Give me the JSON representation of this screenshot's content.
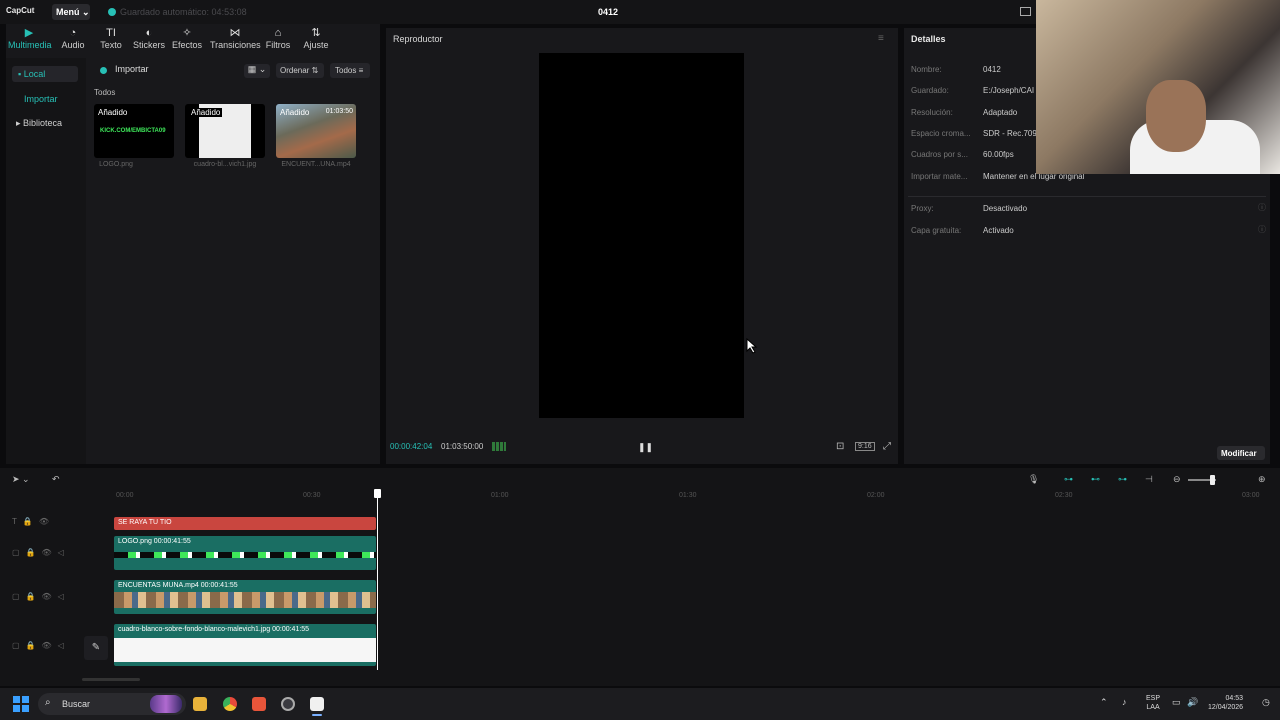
{
  "colors": {
    "accent": "#27c0b6",
    "clip_red": "#c9463f",
    "clip_teal": "#1a6e63"
  },
  "titlebar": {
    "logo": "CapCut",
    "menu_label": "Menú",
    "autosave": "Guardado automático: 04:53:08",
    "project_title": "0412"
  },
  "tools": [
    {
      "label": "Multimedia",
      "icon": "media-icon"
    },
    {
      "label": "Audio",
      "icon": "audio-icon"
    },
    {
      "label": "Texto",
      "icon": "text-icon"
    },
    {
      "label": "Stickers",
      "icon": "sticker-icon"
    },
    {
      "label": "Efectos",
      "icon": "effects-icon"
    },
    {
      "label": "Transiciones",
      "icon": "transition-icon"
    },
    {
      "label": "Filtros",
      "icon": "filter-icon"
    },
    {
      "label": "Ajuste",
      "icon": "adjust-icon"
    }
  ],
  "sidebar": {
    "local": "Local",
    "import": "Importar",
    "library": "Biblioteca"
  },
  "media": {
    "import_label": "Importar",
    "sort_label": "Ordenar",
    "all_label": "Todos",
    "section_label": "Todos",
    "items": [
      {
        "tag": "Añadido",
        "name": "LOGO.png",
        "caption": "KICK.COM/EMBICTA09"
      },
      {
        "tag": "Añadido",
        "name": "cuadro-bl...vich1.jpg"
      },
      {
        "tag": "Añadido",
        "duration": "01:03:50",
        "name": "ENCUENT...UNA.mp4"
      }
    ]
  },
  "player": {
    "title": "Reproductor",
    "current_time": "00:00:42:04",
    "total_time": "01:03:50:00",
    "ratio": "9:16"
  },
  "details": {
    "title": "Detalles",
    "rows": [
      {
        "label": "Nombre:",
        "value": "0412"
      },
      {
        "label": "Guardado:",
        "value": "E:/Joseph/CAI"
      },
      {
        "label": "Resolución:",
        "value": "Adaptado"
      },
      {
        "label": "Espacio croma...",
        "value": "SDR - Rec.709"
      },
      {
        "label": "Cuadros por s...",
        "value": "60.00fps"
      },
      {
        "label": "Importar mate...",
        "value": "Mantener en el lugar original"
      },
      {
        "label": "Proxy:",
        "value": "Desactivado"
      },
      {
        "label": "Capa gratuita:",
        "value": "Activado"
      }
    ],
    "modify_label": "Modificar"
  },
  "timeline": {
    "ruler": [
      "00:00",
      "00:30",
      "01:00",
      "01:30",
      "02:00",
      "02:30",
      "03:00"
    ],
    "clips": [
      {
        "label": "SE RAYA TU TIO"
      },
      {
        "label": "LOGO.png  00:00:41:55"
      },
      {
        "label": "ENCUENTAS MUNA.mp4  00:00:41:55"
      },
      {
        "label": "cuadro-blanco-sobre-fondo-blanco-malevich1.jpg  00:00:41:55"
      }
    ]
  },
  "taskbar": {
    "search": "Buscar",
    "lang_top": "ESP",
    "lang_bottom": "LAA",
    "time": "04:53",
    "date": "12/04/2026"
  }
}
